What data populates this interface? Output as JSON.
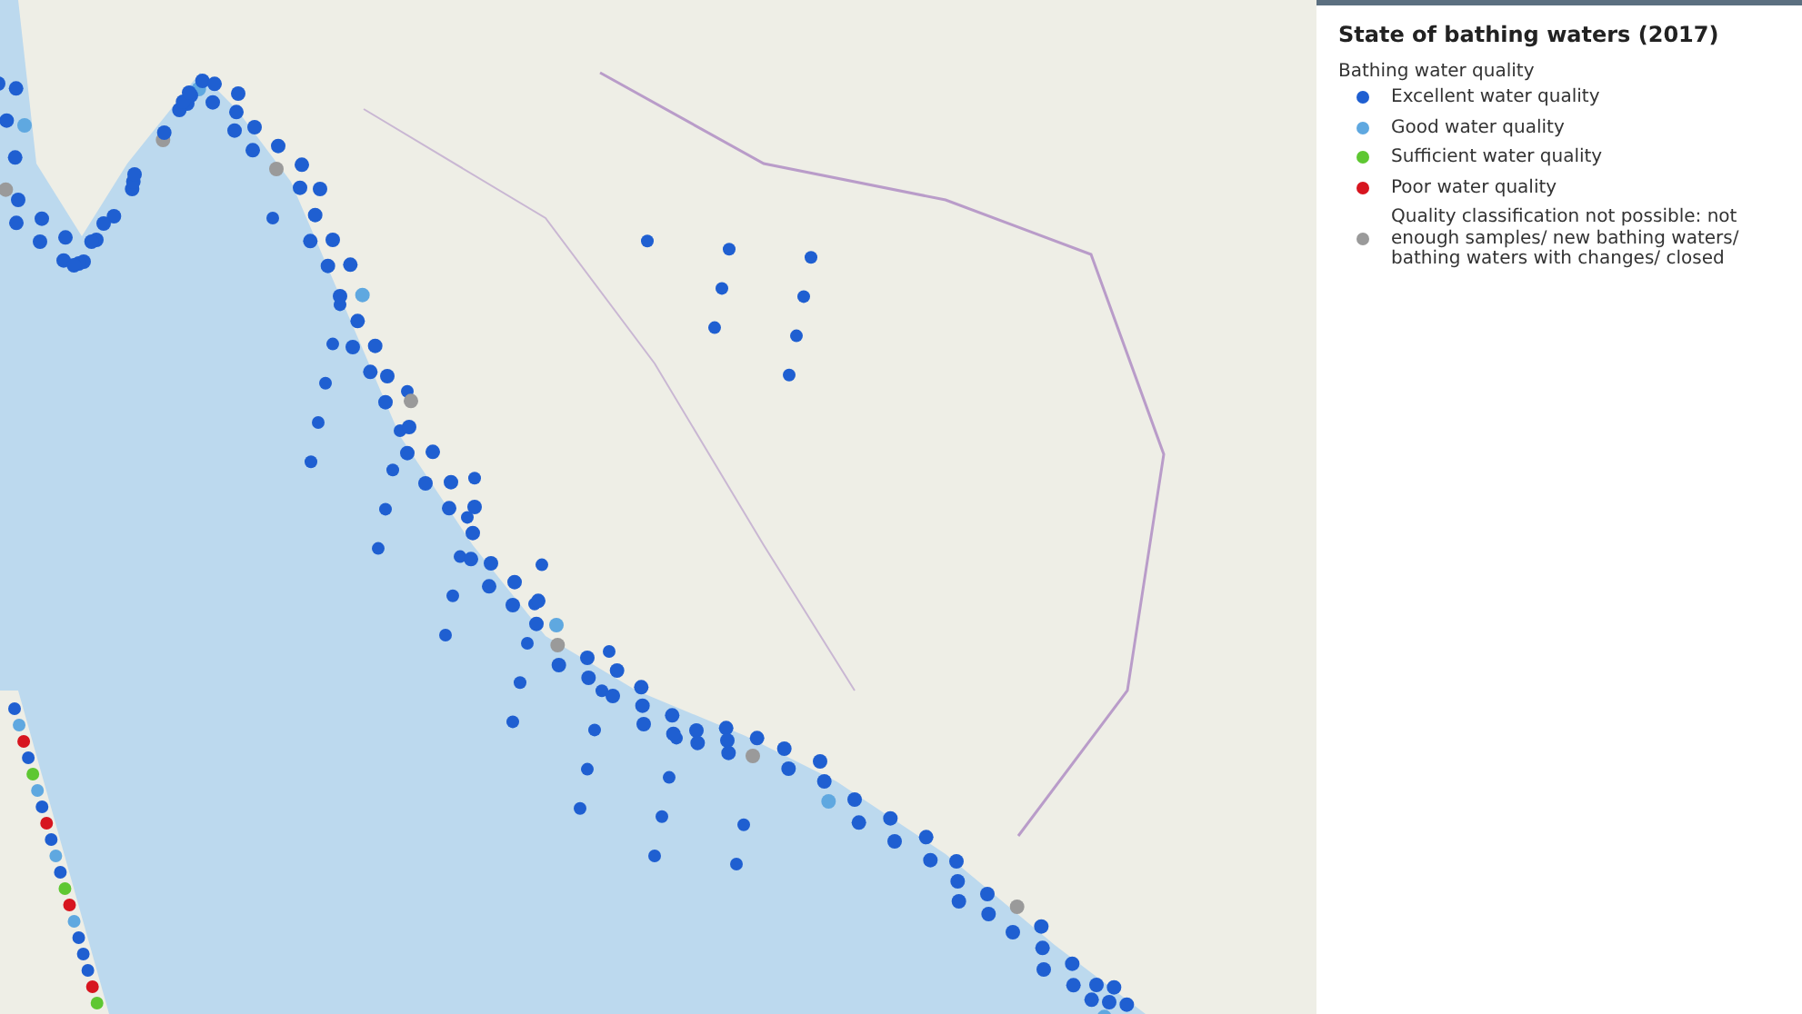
{
  "legend": {
    "title": "State of bathing waters (2017)",
    "subtitle": "Bathing water quality",
    "items": [
      {
        "label": "Excellent water quality",
        "color": "#1f5fd1"
      },
      {
        "label": "Good water quality",
        "color": "#5fa8e0"
      },
      {
        "label": "Sufficient water quality",
        "color": "#5ec732"
      },
      {
        "label": "Poor water quality",
        "color": "#d7151f"
      },
      {
        "label": "Quality classification not possible: not enough samples/ new bathing waters/ bathing waters with changes/ closed",
        "color": "#9a9a9a"
      }
    ]
  }
}
